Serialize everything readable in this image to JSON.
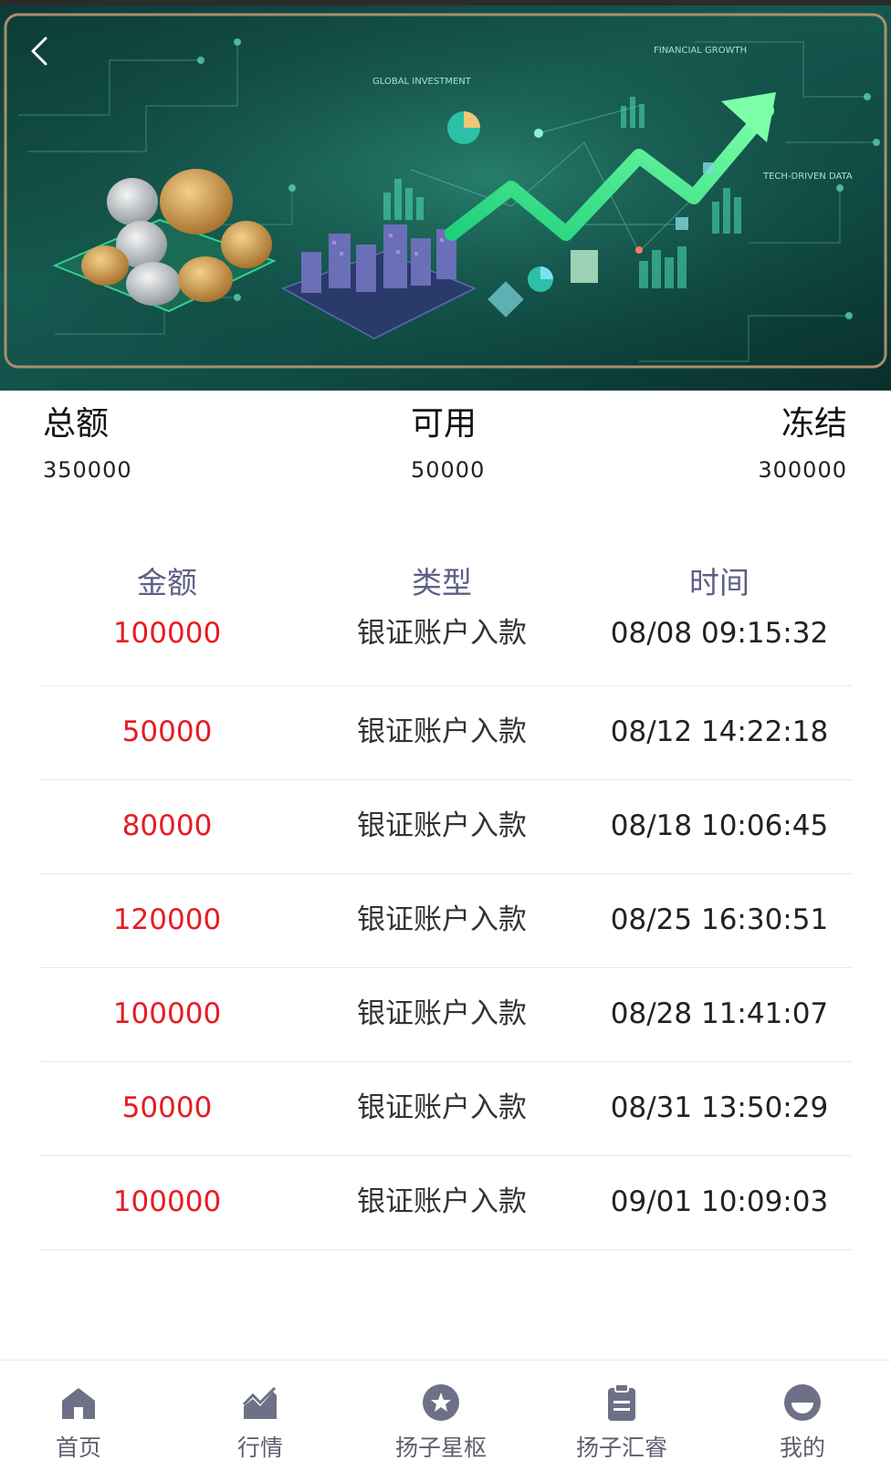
{
  "banner": {
    "labels": {
      "global": "GLOBAL INVESTMENT",
      "growth": "FINANCIAL GROWTH",
      "tech": "TECH-DRIVEN DATA"
    },
    "colors": {
      "bg": "#0f4a44",
      "arrow": "#3cf08a",
      "frame": "#a8906a"
    }
  },
  "summary": {
    "total": {
      "label": "总额",
      "value": "350000"
    },
    "available": {
      "label": "可用",
      "value": "50000"
    },
    "frozen": {
      "label": "冻结",
      "value": "300000"
    }
  },
  "table": {
    "headers": {
      "amount": "金额",
      "type": "类型",
      "time": "时间"
    },
    "rows": [
      {
        "amount": "100000",
        "type": "银证账户入款",
        "time": "08/08 09:15:32"
      },
      {
        "amount": "50000",
        "type": "银证账户入款",
        "time": "08/12 14:22:18"
      },
      {
        "amount": "80000",
        "type": "银证账户入款",
        "time": "08/18 10:06:45"
      },
      {
        "amount": "120000",
        "type": "银证账户入款",
        "time": "08/25 16:30:51"
      },
      {
        "amount": "100000",
        "type": "银证账户入款",
        "time": "08/28 11:41:07"
      },
      {
        "amount": "50000",
        "type": "银证账户入款",
        "time": "08/31 13:50:29"
      },
      {
        "amount": "100000",
        "type": "银证账户入款",
        "time": "09/01 10:09:03"
      }
    ]
  },
  "tabbar": {
    "items": [
      {
        "label": "首页",
        "icon": "home-icon"
      },
      {
        "label": "行情",
        "icon": "chart-icon"
      },
      {
        "label": "扬子星枢",
        "icon": "star-icon"
      },
      {
        "label": "扬子汇睿",
        "icon": "clipboard-icon"
      },
      {
        "label": "我的",
        "icon": "user-icon"
      }
    ],
    "colors": {
      "icon": "#6e7087",
      "label": "#5c5f6e"
    }
  },
  "colors": {
    "amount": "#e51c23",
    "header": "#5e5f86"
  }
}
